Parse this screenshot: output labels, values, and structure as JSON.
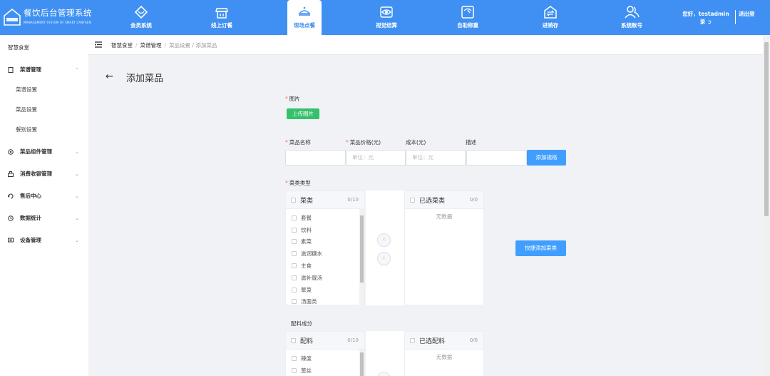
{
  "app": {
    "title": "餐饮后台管理系统",
    "subtitle": "MANAGEMENT SYSTEM OF SMART CANTEEN",
    "logo_text": "智慧食堂"
  },
  "nav": [
    {
      "label": "会员系统",
      "icon": "heart-diamond-icon"
    },
    {
      "label": "线上订餐",
      "icon": "shop-icon"
    },
    {
      "label": "现场点餐",
      "icon": "dining-cloche-icon"
    },
    {
      "label": "视觉结算",
      "icon": "eye-icon"
    },
    {
      "label": "自助称重",
      "icon": "scale-icon"
    },
    {
      "label": "进销存",
      "icon": "house-exchange-icon"
    },
    {
      "label": "系统账号",
      "icon": "users-icon"
    }
  ],
  "nav_active_index": 2,
  "user": {
    "greeting": "您好，testadmin",
    "extra": "录",
    "logout": "退出登"
  },
  "sidebar": {
    "head": "智慧食堂",
    "groups": [
      {
        "label": "菜谱管理",
        "icon": "file-icon",
        "expanded": true,
        "items": [
          "菜谱设置",
          "菜品设置",
          "餐别设置"
        ]
      },
      {
        "label": "菜品组件管理",
        "icon": "target-icon"
      },
      {
        "label": "消费收银管理",
        "icon": "cashier-icon"
      },
      {
        "label": "售后中心",
        "icon": "refresh-icon"
      },
      {
        "label": "数据统计",
        "icon": "clock-icon"
      },
      {
        "label": "设备管理",
        "icon": "device-icon"
      }
    ]
  },
  "breadcrumb": {
    "items": [
      "智慧食堂",
      "菜谱管理",
      "菜品设置",
      "添加菜品"
    ]
  },
  "page": {
    "title": "添加菜品",
    "image_label": "图片",
    "upload_button": "上传图片",
    "fields": {
      "name_label": "菜品名称",
      "price_label": "菜品价格(元)",
      "cost_label": "成本(元)",
      "desc_label": "描述",
      "price_placeholder": "单位：元",
      "cost_placeholder": "单位：元",
      "add_spec_button": "添加规格"
    },
    "category_label": "菜类类型",
    "category_transfer": {
      "left_title": "菜类",
      "left_count": "0/10",
      "left_items": [
        "套餐",
        "饮料",
        "素菜",
        "滋润糖水",
        "主食",
        "滋补靓汤",
        "荤菜",
        "汤面类"
      ],
      "right_title": "已选菜类",
      "right_count": "0/0",
      "empty_text": "无数据"
    },
    "quick_add_button": "快捷添加菜类",
    "ingredient_label": "配料成分",
    "ingredient_transfer": {
      "left_title": "配料",
      "left_count": "0/10",
      "left_items": [
        "辣度",
        "葱丝"
      ],
      "right_title": "已选配料",
      "right_count": "0/0",
      "empty_text": "无数据"
    }
  },
  "colors": {
    "primary": "#3f90f2",
    "accent_blue": "#409eff",
    "success": "#35c16b",
    "required": "#f56c6c"
  }
}
